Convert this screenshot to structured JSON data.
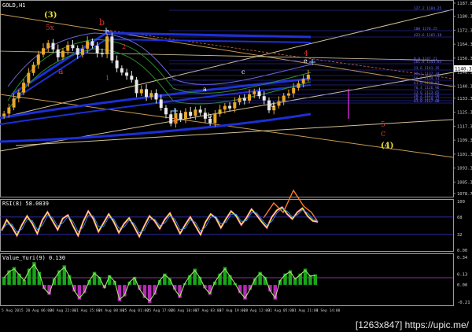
{
  "chart_data": [
    {
      "type": "candlestick",
      "title": "GOLD,H1",
      "symbol": "GOLD",
      "timeframe": "H1",
      "ylim": [
        1078.7,
        1187.8
      ],
      "y_ticks": [
        1187.8,
        1180.3,
        1172.3,
        1164.3,
        1156.3,
        1148.3,
        1140.3,
        1133.3,
        1125.3,
        1117.3,
        1109.3,
        1101.3,
        1093.3,
        1085.3,
        1078.7
      ],
      "x_ticks": [
        "5 Aug 2015",
        "20 Aug 06:00",
        "20 Aug 22:00",
        "21 Aug 15:00",
        "24 Aug 08:00",
        "25 Aug 01:00",
        "25 Aug 17:00",
        "26 Aug 10:00",
        "27 Aug 03:00",
        "27 Aug 19:00",
        "28 Aug 12:00",
        "31 Aug 05:00",
        "31 Aug 21:00",
        "1 Sep 14:00"
      ],
      "close": [
        1124.5,
        1128.0,
        1133.2,
        1136.6,
        1142.2,
        1147.8,
        1152.5,
        1158.3,
        1162.0,
        1165.0,
        1161.3,
        1156.8,
        1160.5,
        1163.8,
        1162.0,
        1158.2,
        1161.7,
        1166.0,
        1163.4,
        1159.0,
        1158.5,
        1168.7,
        1155.0,
        1150.5,
        1148.0,
        1146.2,
        1143.9,
        1136.2,
        1138.5,
        1134.1,
        1136.3,
        1132.6,
        1127.8,
        1124.1,
        1118.8,
        1124.7,
        1121.3,
        1125.5,
        1123.2,
        1126.8,
        1125.0,
        1121.6,
        1119.1,
        1124.3,
        1126.8,
        1128.9,
        1127.5,
        1131.0,
        1133.4,
        1132.0,
        1135.6,
        1137.2,
        1134.5,
        1132.1,
        1126.4,
        1129.0,
        1131.6,
        1134.8,
        1136.1,
        1139.2,
        1141.8,
        1144.4,
        1146.8
      ],
      "current_price": 1140.3,
      "price_levels": [
        "127.2 1184.25",
        "100 1176.25",
        "423.6 1165.18",
        "0.0 1147.21",
        "261.8 1144.85",
        "23.6 1141.35",
        "38.2 1137.34",
        "50.0 1134.11",
        "61.8 1130.87",
        "76.4 1126.96",
        "23.6 1123.65",
        "38.2 1121.56",
        "50.0 1119.72",
        "61.8 1117.88"
      ],
      "wave_labels_yellow": [
        "(3)",
        "(4)"
      ],
      "wave_labels_red": [
        "5x",
        "b",
        "a",
        "1",
        "2",
        "3",
        "4",
        "5",
        "c"
      ],
      "wave_labels_white": [
        "a",
        "b",
        "c",
        "d",
        "e"
      ]
    },
    {
      "type": "line",
      "title": "RSI(8) 58.0039",
      "ylim": [
        0,
        100
      ],
      "y_ticks": [
        "100",
        "68",
        "32",
        "0.00"
      ],
      "series": [
        {
          "values": [
            40,
            62,
            48,
            30,
            52,
            70,
            55,
            34,
            62,
            78,
            60,
            42,
            65,
            72,
            50,
            30,
            58,
            80,
            64,
            38,
            56,
            74,
            58,
            36,
            54,
            66,
            48,
            28,
            50,
            70,
            60,
            44,
            63,
            76,
            55,
            34,
            52,
            68,
            50,
            32,
            58,
            74,
            66,
            46,
            64,
            80,
            70,
            52,
            66,
            84,
            72,
            58,
            46,
            68,
            82,
            88,
            74,
            64,
            78,
            86,
            70,
            60,
            58
          ]
        }
      ]
    },
    {
      "type": "bar",
      "title": "Value_Yuri(9) 0.130",
      "ylim": [
        -0.25,
        0.35
      ],
      "y_ticks": [
        "0.34",
        "0.13",
        "0.00",
        "-0.21"
      ],
      "values": [
        0.1,
        0.18,
        0.22,
        0.14,
        0.06,
        0.2,
        0.28,
        0.16,
        -0.05,
        -0.12,
        0.08,
        0.18,
        0.24,
        0.12,
        -0.08,
        -0.18,
        -0.1,
        0.06,
        0.16,
        0.1,
        -0.04,
        0.12,
        0.05,
        -0.2,
        -0.14,
        0.04,
        0.1,
        -0.06,
        -0.16,
        -0.22,
        -0.12,
        0.06,
        0.14,
        0.08,
        -0.06,
        -0.16,
        0.02,
        0.12,
        0.2,
        0.1,
        -0.04,
        -0.12,
        0.04,
        0.14,
        0.22,
        0.12,
        0.02,
        -0.1,
        -0.18,
        -0.06,
        0.08,
        0.16,
        0.1,
        -0.08,
        -0.18,
        0.06,
        0.14,
        0.18,
        0.08,
        0.14,
        0.2,
        0.12,
        0.13
      ]
    }
  ],
  "watermark": "[1263x847] https://upic.me/"
}
